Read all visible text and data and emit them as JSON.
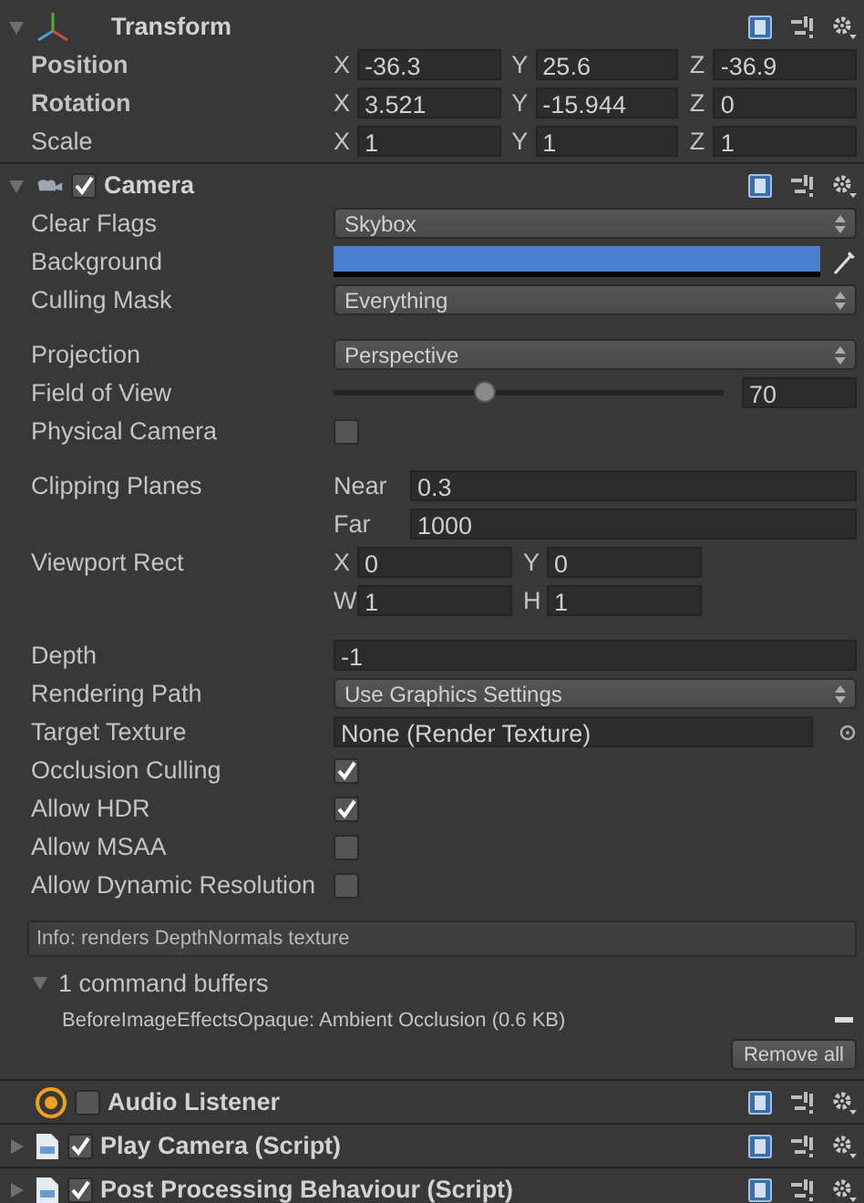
{
  "transform": {
    "title": "Transform",
    "expanded": true,
    "rows": [
      {
        "label": "Position",
        "modified": true,
        "fields": [
          {
            "axis": "X",
            "value": "-36.3"
          },
          {
            "axis": "Y",
            "value": "25.6"
          },
          {
            "axis": "Z",
            "value": "-36.9"
          }
        ]
      },
      {
        "label": "Rotation",
        "modified": true,
        "fields": [
          {
            "axis": "X",
            "value": "3.521"
          },
          {
            "axis": "Y",
            "value": "-15.944"
          },
          {
            "axis": "Z",
            "value": "0"
          }
        ]
      },
      {
        "label": "Scale",
        "modified": false,
        "fields": [
          {
            "axis": "X",
            "value": "1"
          },
          {
            "axis": "Y",
            "value": "1"
          },
          {
            "axis": "Z",
            "value": "1"
          }
        ]
      }
    ]
  },
  "camera": {
    "title": "Camera",
    "enabled": true,
    "expanded": true,
    "groups": [
      {
        "rows": [
          {
            "label": "Clear Flags",
            "kind": "dropdown",
            "value": "Skybox"
          },
          {
            "label": "Background",
            "kind": "color",
            "color": "#4a7ed0"
          },
          {
            "label": "Culling Mask",
            "kind": "dropdown",
            "value": "Everything"
          }
        ]
      },
      {
        "rows": [
          {
            "label": "Projection",
            "kind": "dropdown",
            "value": "Perspective"
          },
          {
            "label": "Field of View",
            "kind": "slider",
            "level": 0.39,
            "value": "70"
          },
          {
            "label": "Physical Camera",
            "kind": "checkbox",
            "checked": false
          }
        ]
      },
      {
        "rows": [
          {
            "label": "Clipping Planes",
            "kind": "planes",
            "lines": [
              {
                "name": "Near",
                "value": "0.3"
              },
              {
                "name": "Far",
                "value": "1000"
              }
            ]
          },
          {
            "label": "Viewport Rect",
            "kind": "rect",
            "lines": [
              [
                {
                  "axis": "X",
                  "value": "0"
                },
                {
                  "axis": "Y",
                  "value": "0"
                }
              ],
              [
                {
                  "axis": "W",
                  "value": "1"
                },
                {
                  "axis": "H",
                  "value": "1"
                }
              ]
            ]
          }
        ]
      },
      {
        "rows": [
          {
            "label": "Depth",
            "kind": "number",
            "value": "-1"
          },
          {
            "label": "Rendering Path",
            "kind": "dropdown",
            "value": "Use Graphics Settings"
          },
          {
            "label": "Target Texture",
            "kind": "object",
            "value": "None (Render Texture)"
          },
          {
            "label": "Occlusion Culling",
            "kind": "checkbox",
            "checked": true
          },
          {
            "label": "Allow HDR",
            "kind": "checkbox",
            "checked": true
          },
          {
            "label": "Allow MSAA",
            "kind": "checkbox",
            "checked": false
          },
          {
            "label": "Allow Dynamic Resolution",
            "kind": "checkbox",
            "checked": false
          }
        ]
      }
    ],
    "info": "Info: renders DepthNormals texture",
    "command_buffers": {
      "title": "1 command buffers",
      "expanded": true,
      "items": [
        "BeforeImageEffectsOpaque: Ambient Occlusion (0.6 KB)"
      ],
      "button": "Remove all"
    }
  },
  "components": [
    {
      "title": "Audio Listener",
      "kind": "audio",
      "foldout": false,
      "enabled": false
    },
    {
      "title": "Play Camera (Script)",
      "kind": "script",
      "foldout": true,
      "enabled": true
    },
    {
      "title": "Post Processing Behaviour (Script)",
      "kind": "script",
      "foldout": true,
      "enabled": true
    }
  ]
}
